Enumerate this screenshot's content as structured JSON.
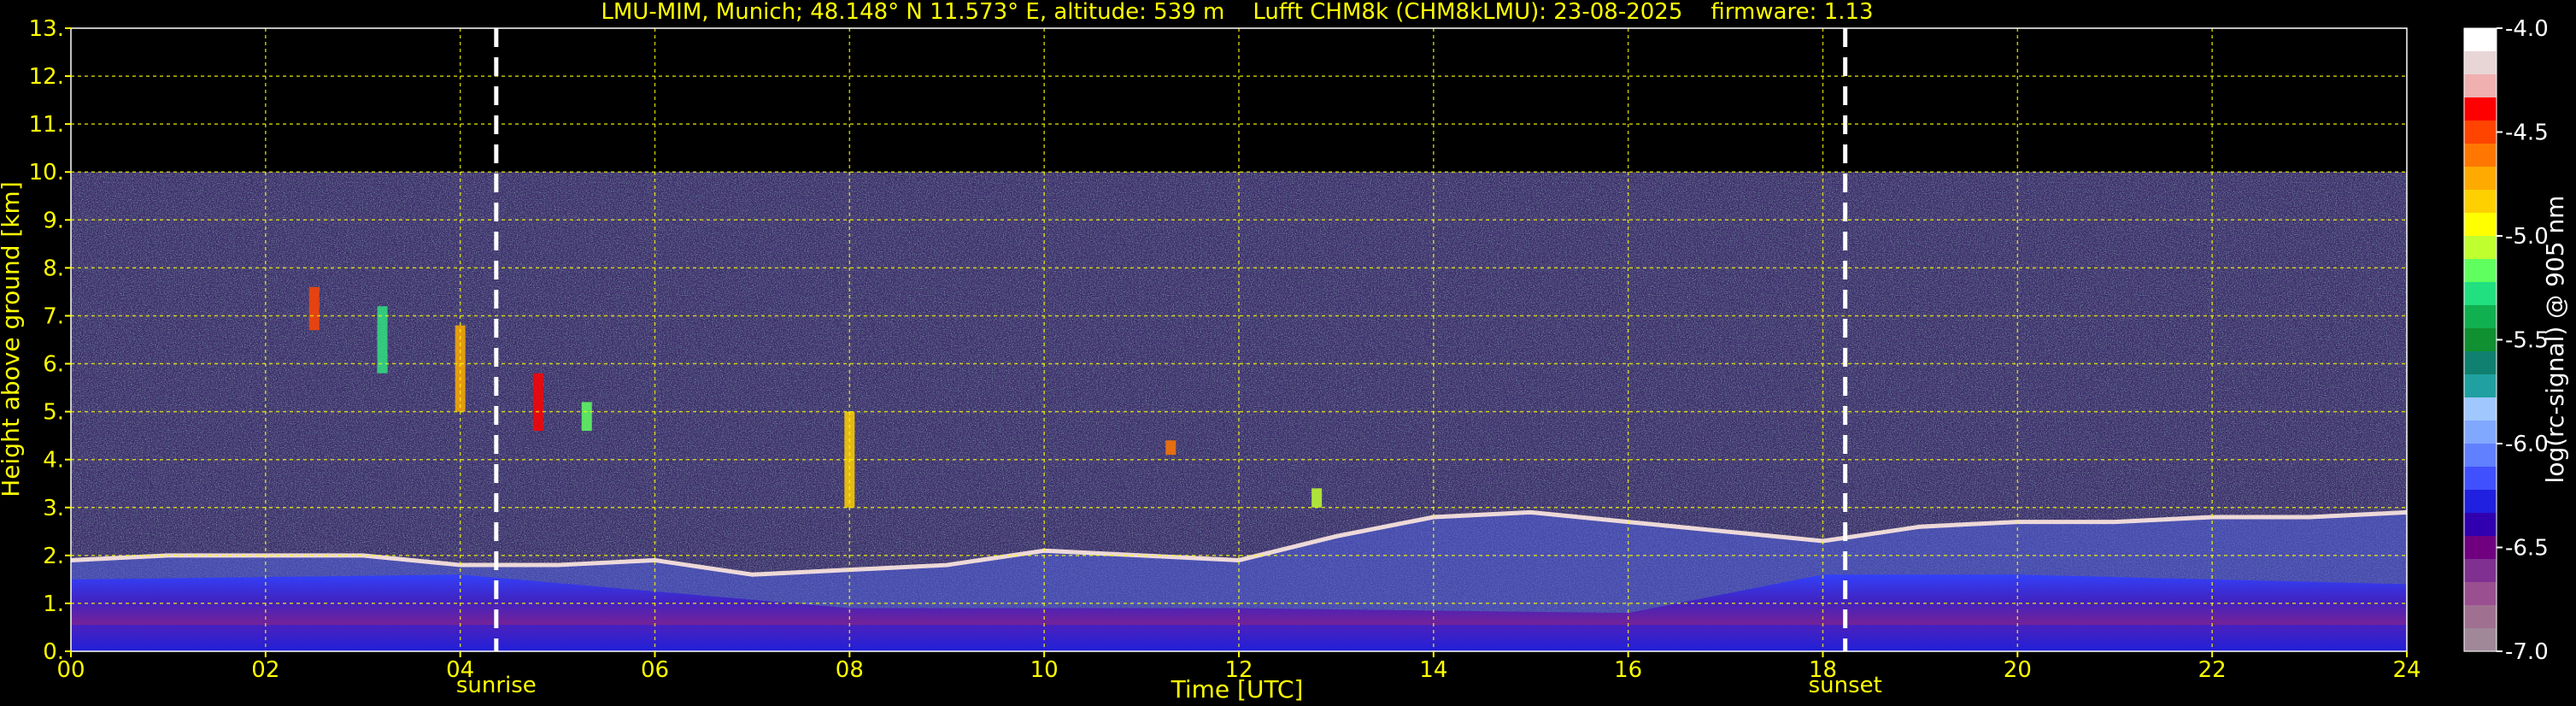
{
  "chart_data": {
    "type": "heatmap",
    "title": "LMU-MIM, Munich; 48.148° N 11.573° E, altitude: 539 m    Lufft CHM8k (CHM8kLMU): 23-08-2025    firmware: 1.13",
    "xlabel": "Time [UTC]",
    "ylabel": "Height above ground [km]",
    "xlim": [
      0,
      24
    ],
    "ylim": [
      0,
      13
    ],
    "x_ticks": [
      "00",
      "02",
      "04",
      "06",
      "08",
      "10",
      "12",
      "14",
      "16",
      "18",
      "20",
      "22",
      "24"
    ],
    "y_ticks": [
      "0.",
      "1.",
      "2.",
      "3.",
      "4.",
      "5.",
      "6.",
      "7.",
      "8.",
      "9.",
      "10.",
      "11.",
      "12.",
      "13."
    ],
    "grid": true,
    "data_top_km": 10,
    "markers": [
      {
        "label": "sunrise",
        "time": 4.37
      },
      {
        "label": "sunset",
        "time": 18.23
      }
    ],
    "colorbar": {
      "label": "log(rc-signal) @ 905 nm",
      "range": [
        -7.0,
        -4.0
      ],
      "tick_labels": [
        "-4.0",
        "-4.5",
        "-5.0",
        "-5.5",
        "-6.0",
        "-6.5",
        "-7.0"
      ],
      "colors": [
        "#ffffff",
        "#e8d6d6",
        "#f0b0b0",
        "#ff0000",
        "#ff4400",
        "#ff7700",
        "#ffaa00",
        "#ffd000",
        "#ffff00",
        "#c0ff30",
        "#60ff60",
        "#20e080",
        "#10b050",
        "#109030",
        "#108070",
        "#20a0a0",
        "#a0c8ff",
        "#80a8ff",
        "#6080ff",
        "#4050ff",
        "#2020e0",
        "#3000b0",
        "#700080",
        "#803090",
        "#9a5090",
        "#a07090",
        "#a08898"
      ]
    },
    "features": {
      "boundary_layer_top_km": [
        [
          0,
          1.9
        ],
        [
          1,
          2.0
        ],
        [
          2,
          2.0
        ],
        [
          3,
          2.0
        ],
        [
          4,
          1.8
        ],
        [
          5,
          1.8
        ],
        [
          6,
          1.9
        ],
        [
          7,
          1.6
        ],
        [
          8,
          1.7
        ],
        [
          9,
          1.8
        ],
        [
          10,
          2.1
        ],
        [
          11,
          2.0
        ],
        [
          12,
          1.9
        ],
        [
          13,
          2.4
        ],
        [
          14,
          2.8
        ],
        [
          15,
          2.9
        ],
        [
          16,
          2.7
        ],
        [
          17,
          2.5
        ],
        [
          18,
          2.3
        ],
        [
          19,
          2.6
        ],
        [
          20,
          2.7
        ],
        [
          21,
          2.7
        ],
        [
          22,
          2.8
        ],
        [
          23,
          2.8
        ],
        [
          24,
          2.9
        ]
      ],
      "lower_layer_top_km": [
        [
          0,
          1.5
        ],
        [
          4,
          1.6
        ],
        [
          8,
          0.9
        ],
        [
          12,
          0.9
        ],
        [
          16,
          0.8
        ],
        [
          18,
          1.6
        ],
        [
          20,
          1.6
        ],
        [
          24,
          1.4
        ]
      ],
      "clouds": [
        {
          "time": 2.5,
          "bottom_km": 6.7,
          "top_km": 7.6
        },
        {
          "time": 3.2,
          "bottom_km": 5.8,
          "top_km": 7.2
        },
        {
          "time": 4.0,
          "bottom_km": 5.0,
          "top_km": 6.8
        },
        {
          "time": 4.8,
          "bottom_km": 4.6,
          "top_km": 5.8
        },
        {
          "time": 5.3,
          "bottom_km": 4.6,
          "top_km": 5.2
        },
        {
          "time": 8.0,
          "bottom_km": 3.0,
          "top_km": 5.0
        },
        {
          "time": 11.3,
          "bottom_km": 4.1,
          "top_km": 4.4
        },
        {
          "time": 12.8,
          "bottom_km": 3.0,
          "top_km": 3.4
        }
      ]
    }
  }
}
